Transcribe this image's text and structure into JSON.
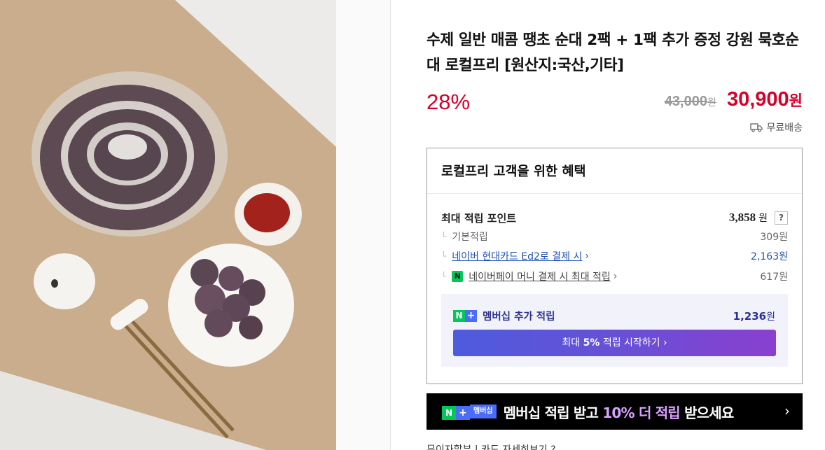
{
  "product": {
    "title": "수제 일반 매콤 땡초 순대 2팩 + 1팩 추가 증정 강원 묵호순대 로컬프리 [원산지:국산,기타]",
    "discount": "28%",
    "original_price": "43,000",
    "original_unit": "원",
    "sale_price": "30,900",
    "sale_unit": "원",
    "shipping": "무료배송"
  },
  "benefit": {
    "title": "로컬프리 고객을 위한 혜택",
    "max_points_label": "최대 적립 포인트",
    "max_points_value": "3,858",
    "unit": "원",
    "help": "?",
    "rows": [
      {
        "label": "기본적립",
        "value": "309원"
      },
      {
        "label": "네이버 현대카드 Ed2로 결제 시",
        "value": "2,163원"
      },
      {
        "label": "네이버페이 머니 결제 시 최대 적립",
        "value": "617원"
      }
    ],
    "npay_badge": "N",
    "tree_glyph": "└",
    "chevron": "›",
    "membership": {
      "badge_n": "N",
      "badge_plus": "+",
      "label": "멤버십 추가 적립",
      "value": "1,236",
      "unit": "원",
      "button_prefix": "최대 ",
      "button_bold": "5%",
      "button_suffix": " 적립 시작하기 ›"
    }
  },
  "banner": {
    "badge_n": "N",
    "badge_plus": "+",
    "chip": "멤버십",
    "text_1": "멤버십 적립 받고 ",
    "text_highlight": "10% 더 적립",
    "text_2": " 받으세요",
    "arrow": "›"
  },
  "footer_partial": "무이자할부 | 카드 자세히보기 ?",
  "colors": {
    "accent_red": "#d8002a",
    "link_blue": "#1f52b8",
    "naver_green": "#03c75a",
    "membership_purple": "#8a3fcf"
  }
}
